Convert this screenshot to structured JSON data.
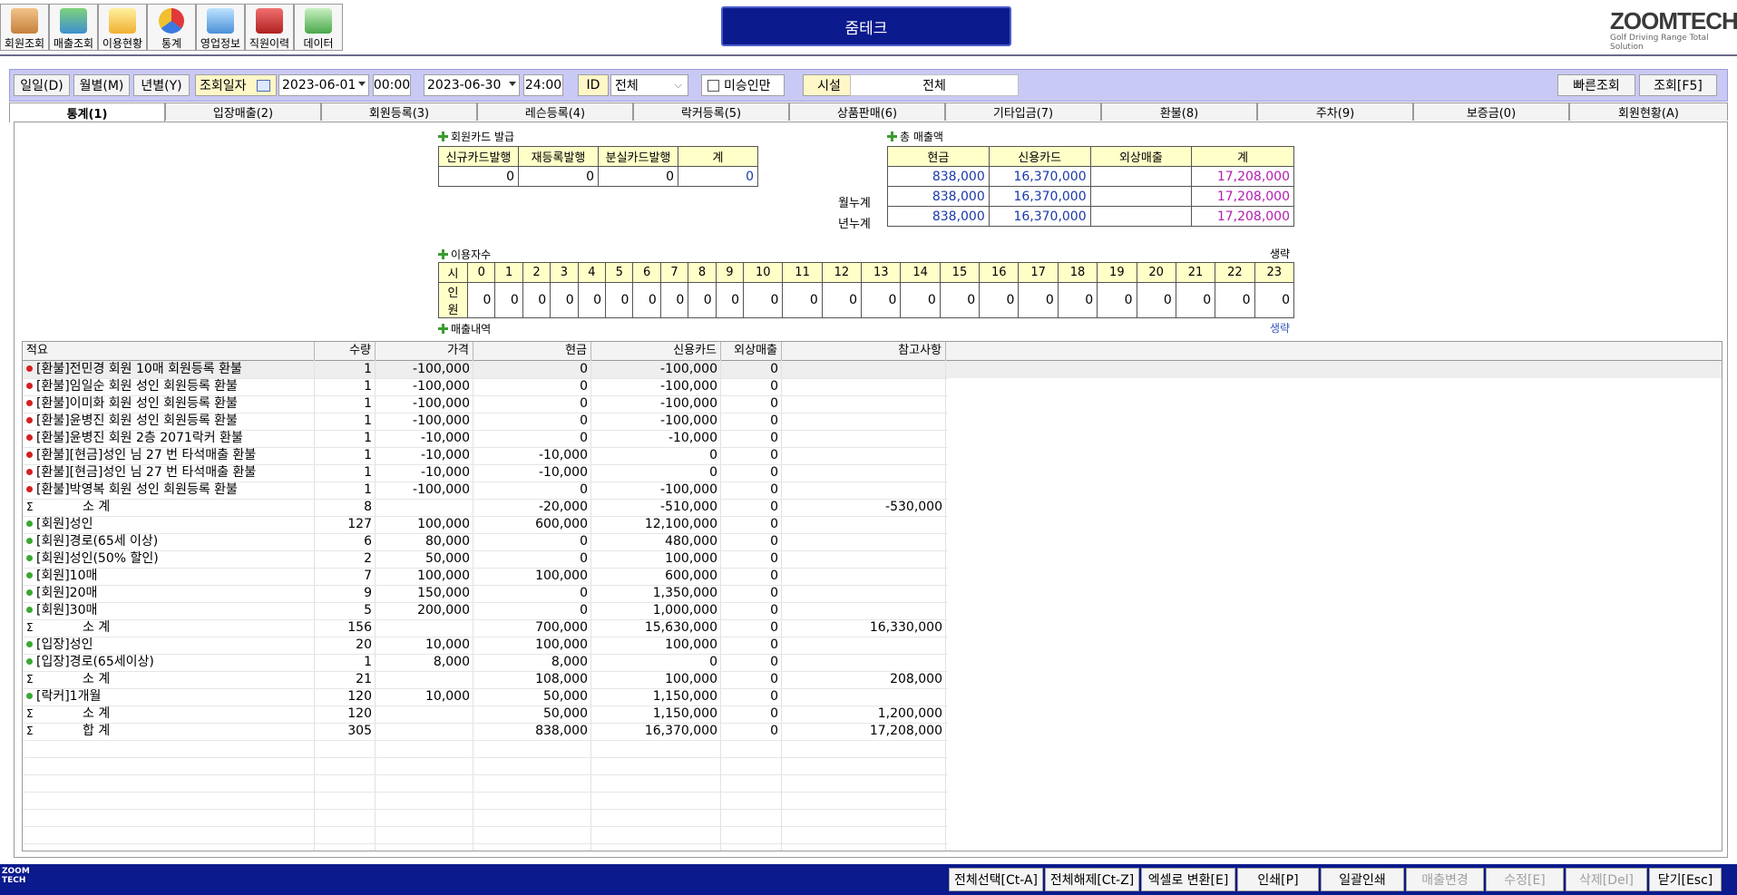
{
  "toolbar": {
    "buttons": [
      {
        "label": "회원조회",
        "icon": "members-icon"
      },
      {
        "label": "매출조회",
        "icon": "sales-icon"
      },
      {
        "label": "이용현황",
        "icon": "usage-icon"
      },
      {
        "label": "통계",
        "icon": "stats-icon"
      },
      {
        "label": "영업정보",
        "icon": "business-info-icon"
      },
      {
        "label": "직원이력",
        "icon": "staff-history-icon"
      },
      {
        "label": "데이터",
        "icon": "data-icon"
      }
    ],
    "title": "줌테크",
    "logo": {
      "brand": "ZOOMTECH",
      "tagline": "Golf Driving Range Total Solution"
    }
  },
  "filter": {
    "daily": "일일(D)",
    "monthly": "월별(M)",
    "yearly": "년별(Y)",
    "date_label": "조회일자",
    "from_date": "2023-06-01",
    "from_time": "00:00",
    "to_date": "2023-06-30",
    "to_time": "24:00",
    "id_label": "ID",
    "id_value": "전체",
    "unapproved_label": "미승인만",
    "facility_label": "시설",
    "facility_value": "전체",
    "quick_search": "빠른조회",
    "search": "조회[F5]"
  },
  "tabs": [
    "통계(1)",
    "입장매출(2)",
    "회원등록(3)",
    "레슨등록(4)",
    "락커등록(5)",
    "상품판매(6)",
    "기타입금(7)",
    "환불(8)",
    "주차(9)",
    "보증금(0)",
    "회원현황(A)"
  ],
  "member_card": {
    "title": "회원카드 발급",
    "headers": [
      "신규카드발행",
      "재등록발행",
      "분실카드발행",
      "계"
    ],
    "values": [
      "0",
      "0",
      "0",
      "0"
    ]
  },
  "total_sales": {
    "title": "총 매출액",
    "headers": [
      "현금",
      "신용카드",
      "외상매출",
      "계"
    ],
    "rows": [
      {
        "label": "",
        "values": [
          "838,000",
          "16,370,000",
          "",
          "17,208,000"
        ]
      },
      {
        "label": "월누계",
        "values": [
          "838,000",
          "16,370,000",
          "",
          "17,208,000"
        ]
      },
      {
        "label": "년누계",
        "values": [
          "838,000",
          "16,370,000",
          "",
          "17,208,000"
        ]
      }
    ]
  },
  "usage": {
    "title": "이용자수",
    "omit": "생략",
    "hour_label": "시",
    "count_label": "인원",
    "hours": [
      "0",
      "1",
      "2",
      "3",
      "4",
      "5",
      "6",
      "7",
      "8",
      "9",
      "10",
      "11",
      "12",
      "13",
      "14",
      "15",
      "16",
      "17",
      "18",
      "19",
      "20",
      "21",
      "22",
      "23"
    ],
    "counts": [
      "0",
      "0",
      "0",
      "0",
      "0",
      "0",
      "0",
      "0",
      "0",
      "0",
      "0",
      "0",
      "0",
      "0",
      "0",
      "0",
      "0",
      "0",
      "0",
      "0",
      "0",
      "0",
      "0",
      "0"
    ]
  },
  "sales_detail": {
    "title": "매출내역",
    "omit": "생략",
    "columns": [
      "적요",
      "수량",
      "가격",
      "현금",
      "신용카드",
      "외상매출",
      "참고사항"
    ],
    "rows": [
      {
        "mark": "red",
        "desc": "[환불]전민경 회원 10매 회원등록 환불",
        "qty": "1",
        "price": "-100,000",
        "cash": "0",
        "card": "-100,000",
        "credit": "0",
        "note": ""
      },
      {
        "mark": "red",
        "desc": "[환불]임일순 회원 성인 회원등록 환불",
        "qty": "1",
        "price": "-100,000",
        "cash": "0",
        "card": "-100,000",
        "credit": "0",
        "note": ""
      },
      {
        "mark": "red",
        "desc": "[환불]이미화 회원 성인 회원등록 환불",
        "qty": "1",
        "price": "-100,000",
        "cash": "0",
        "card": "-100,000",
        "credit": "0",
        "note": ""
      },
      {
        "mark": "red",
        "desc": "[환불]윤병진 회원 성인 회원등록 환불",
        "qty": "1",
        "price": "-100,000",
        "cash": "0",
        "card": "-100,000",
        "credit": "0",
        "note": ""
      },
      {
        "mark": "red",
        "desc": "[환불]윤병진 회원 2층 2071락커 환불",
        "qty": "1",
        "price": "-10,000",
        "cash": "0",
        "card": "-10,000",
        "credit": "0",
        "note": ""
      },
      {
        "mark": "red",
        "desc": "[환불][현금]성인 님 27 번 타석매출 환불",
        "qty": "1",
        "price": "-10,000",
        "cash": "-10,000",
        "card": "0",
        "credit": "0",
        "note": ""
      },
      {
        "mark": "red",
        "desc": "[환불][현금]성인 님 27 번 타석매출 환불",
        "qty": "1",
        "price": "-10,000",
        "cash": "-10,000",
        "card": "0",
        "credit": "0",
        "note": ""
      },
      {
        "mark": "red",
        "desc": "[환불]박영복 회원 성인 회원등록 환불",
        "qty": "1",
        "price": "-100,000",
        "cash": "0",
        "card": "-100,000",
        "credit": "0",
        "note": ""
      },
      {
        "mark": "sigma",
        "desc": "소 계",
        "qty": "8",
        "price": "",
        "cash": "-20,000",
        "card": "-510,000",
        "credit": "0",
        "note": "-530,000"
      },
      {
        "mark": "green",
        "desc": "[회원]성인",
        "qty": "127",
        "price": "100,000",
        "cash": "600,000",
        "card": "12,100,000",
        "credit": "0",
        "note": ""
      },
      {
        "mark": "green",
        "desc": "[회원]경로(65세 이상)",
        "qty": "6",
        "price": "80,000",
        "cash": "0",
        "card": "480,000",
        "credit": "0",
        "note": ""
      },
      {
        "mark": "green",
        "desc": "[회원]성인(50% 할인)",
        "qty": "2",
        "price": "50,000",
        "cash": "0",
        "card": "100,000",
        "credit": "0",
        "note": ""
      },
      {
        "mark": "green",
        "desc": "[회원]10매",
        "qty": "7",
        "price": "100,000",
        "cash": "100,000",
        "card": "600,000",
        "credit": "0",
        "note": ""
      },
      {
        "mark": "green",
        "desc": "[회원]20매",
        "qty": "9",
        "price": "150,000",
        "cash": "0",
        "card": "1,350,000",
        "credit": "0",
        "note": ""
      },
      {
        "mark": "green",
        "desc": "[회원]30매",
        "qty": "5",
        "price": "200,000",
        "cash": "0",
        "card": "1,000,000",
        "credit": "0",
        "note": ""
      },
      {
        "mark": "sigma",
        "desc": "소 계",
        "qty": "156",
        "price": "",
        "cash": "700,000",
        "card": "15,630,000",
        "credit": "0",
        "note": "16,330,000"
      },
      {
        "mark": "green",
        "desc": "[입장]성인",
        "qty": "20",
        "price": "10,000",
        "cash": "100,000",
        "card": "100,000",
        "credit": "0",
        "note": ""
      },
      {
        "mark": "green",
        "desc": "[입장]경로(65세이상)",
        "qty": "1",
        "price": "8,000",
        "cash": "8,000",
        "card": "0",
        "credit": "0",
        "note": ""
      },
      {
        "mark": "sigma",
        "desc": "소 계",
        "qty": "21",
        "price": "",
        "cash": "108,000",
        "card": "100,000",
        "credit": "0",
        "note": "208,000"
      },
      {
        "mark": "green",
        "desc": "[락커]1개월",
        "qty": "120",
        "price": "10,000",
        "cash": "50,000",
        "card": "1,150,000",
        "credit": "0",
        "note": ""
      },
      {
        "mark": "sigma",
        "desc": "소 계",
        "qty": "120",
        "price": "",
        "cash": "50,000",
        "card": "1,150,000",
        "credit": "0",
        "note": "1,200,000"
      },
      {
        "mark": "sigma",
        "desc": "합 계",
        "qty": "305",
        "price": "",
        "cash": "838,000",
        "card": "16,370,000",
        "credit": "0",
        "note": "17,208,000"
      }
    ]
  },
  "bottom": {
    "buttons": [
      {
        "label": "전체선택[Ct-A]",
        "enabled": true
      },
      {
        "label": "전체해제[Ct-Z]",
        "enabled": true
      },
      {
        "label": "엑셀로 변환[E]",
        "enabled": true
      },
      {
        "label": "인쇄[P]",
        "enabled": true
      },
      {
        "label": "일괄인쇄",
        "enabled": true
      },
      {
        "label": "매출변경",
        "enabled": false
      },
      {
        "label": "수정[E]",
        "enabled": false
      },
      {
        "label": "삭제[Del]",
        "enabled": false
      },
      {
        "label": "닫기[Esc]",
        "enabled": true
      }
    ],
    "logo": "ZOOM TECH"
  },
  "colors": {
    "title_bg": "#0b1a8c",
    "filter_bg": "#c9c9f5",
    "header_yellow": "#ffffc8",
    "value_blue": "#1a3aa8",
    "total_purple": "#b020b0",
    "refund_red": "#d42020",
    "item_green": "#3aa832"
  }
}
